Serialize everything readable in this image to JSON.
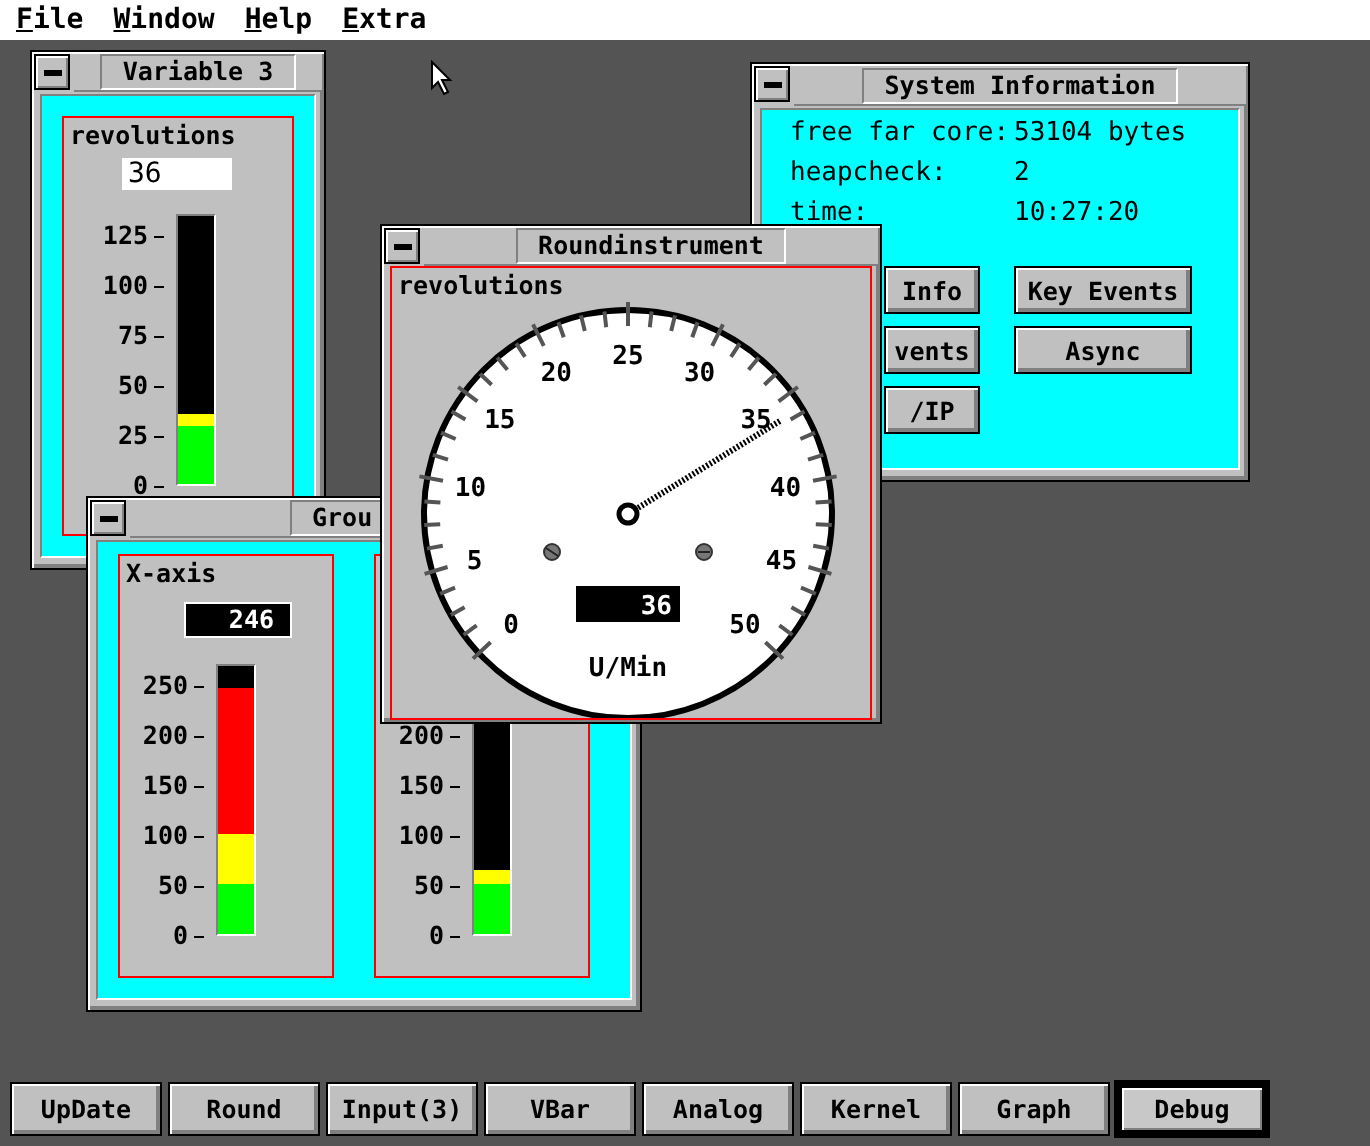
{
  "menu": [
    {
      "label": "File"
    },
    {
      "label": "Window"
    },
    {
      "label": "Help"
    },
    {
      "label": "Extra"
    }
  ],
  "variable_window": {
    "title": "Variable 3",
    "label": "revolutions",
    "value": "36",
    "scale": [
      "125",
      "100",
      "75",
      "50",
      "25",
      "0"
    ],
    "segments": [
      {
        "color": "#00ff00",
        "level": 0.22
      },
      {
        "color": "#ffff00",
        "level": 0.26
      }
    ]
  },
  "system_window": {
    "title": "System Information",
    "info": [
      {
        "label": "free far core:",
        "value": "53104 bytes"
      },
      {
        "label": "heapcheck:",
        "value": "2"
      },
      {
        "label": "time:",
        "value": "10:27:20"
      }
    ],
    "buttons": [
      "Info",
      "Key Events",
      "vents",
      "Async",
      "/IP"
    ]
  },
  "round_window": {
    "title": "Roundinstrument",
    "label": "revolutions",
    "dial": [
      "0",
      "5",
      "10",
      "15",
      "20",
      "25",
      "30",
      "35",
      "40",
      "45",
      "50"
    ],
    "level": 0.72,
    "value": "36",
    "unit": "U/Min"
  },
  "group_window": {
    "title": "Grou",
    "meters": [
      {
        "label": "X-axis",
        "value": "246",
        "scale": [
          "250",
          "200",
          "150",
          "100",
          "50",
          "0"
        ],
        "segments": [
          {
            "color": "#00ff00",
            "level": 0.19
          },
          {
            "color": "#ffff00",
            "level": 0.37
          },
          {
            "color": "#ff0000",
            "level": 0.92
          }
        ]
      },
      {
        "scale": [
          "200",
          "150",
          "100",
          "50",
          "0"
        ],
        "segments": [
          {
            "color": "#00ff00",
            "level": 0.19
          },
          {
            "color": "#ffff00",
            "level": 0.24
          }
        ]
      }
    ]
  },
  "taskbar": [
    {
      "label": "UpDate",
      "selected": false
    },
    {
      "label": "Round",
      "selected": false
    },
    {
      "label": "Input(3)",
      "selected": false
    },
    {
      "label": "VBar",
      "selected": false
    },
    {
      "label": "Analog",
      "selected": false
    },
    {
      "label": "Kernel",
      "selected": false
    },
    {
      "label": "Graph",
      "selected": false
    },
    {
      "label": "Debug",
      "selected": true
    }
  ]
}
